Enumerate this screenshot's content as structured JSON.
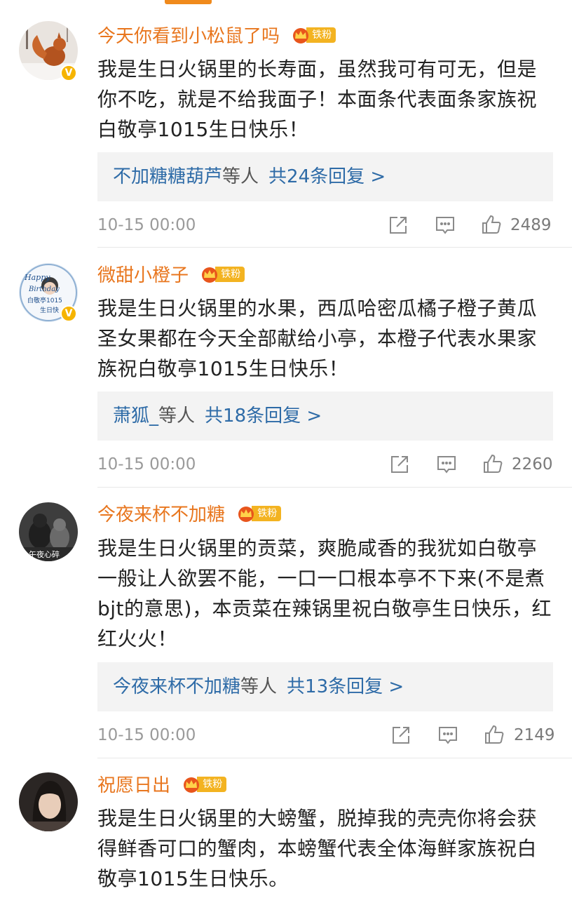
{
  "colors": {
    "accent": "#f08a1c",
    "username": "#e8761e",
    "link": "#2e6ba7",
    "badge": "#f3b321"
  },
  "comments": [
    {
      "username": "今天你看到小松鼠了吗",
      "badge": "铁粉",
      "text": "我是生日火锅里的长寿面，虽然我可有可无，但是你不吃，就是不给我面子！本面条代表面条家族祝白敬亭1015生日快乐！",
      "reply_names": "不加糖糖葫芦",
      "reply_etc": "等人",
      "reply_count": "共24条回复 >",
      "time": "10-15 00:00",
      "likes": "2489",
      "verified": true
    },
    {
      "username": "微甜小橙子",
      "badge": "铁粉",
      "text": "我是生日火锅里的水果，西瓜哈密瓜橘子橙子黄瓜圣女果都在今天全部献给小亭，本橙子代表水果家族祝白敬亭1015生日快乐！",
      "reply_names": "萧狐_",
      "reply_etc": "等人",
      "reply_count": "共18条回复 >",
      "time": "10-15 00:00",
      "likes": "2260",
      "verified": true,
      "avatar_text": [
        "Happy",
        "Birthday",
        "白敬亭1015",
        "生日快"
      ]
    },
    {
      "username": "今夜来杯不加糖",
      "badge": "铁粉",
      "text": "我是生日火锅里的贡菜，爽脆咸香的我犹如白敬亭一般让人欲罢不能，一口一口根本亭不下来(不是煮bjt的意思)，本贡菜在辣锅里祝白敬亭生日快乐，红红火火！",
      "reply_names": "今夜来杯不加糖",
      "reply_etc": "等人",
      "reply_count": "共13条回复 >",
      "time": "10-15 00:00",
      "likes": "2149",
      "verified": false,
      "avatar_text": [
        "午夜心碎"
      ]
    },
    {
      "username": "祝愿日出",
      "badge": "铁粉",
      "text": "我是生日火锅里的大螃蟹，脱掉我的壳壳你将会获得鲜香可口的蟹肉，本螃蟹代表全体海鲜家族祝白敬亭1015生日快乐。",
      "verified": false
    }
  ],
  "icons": {
    "share": "share-icon",
    "reply": "comment-icon",
    "like": "thumbs-up-icon",
    "crown": "crown-icon",
    "verified": "verified-v-icon"
  }
}
